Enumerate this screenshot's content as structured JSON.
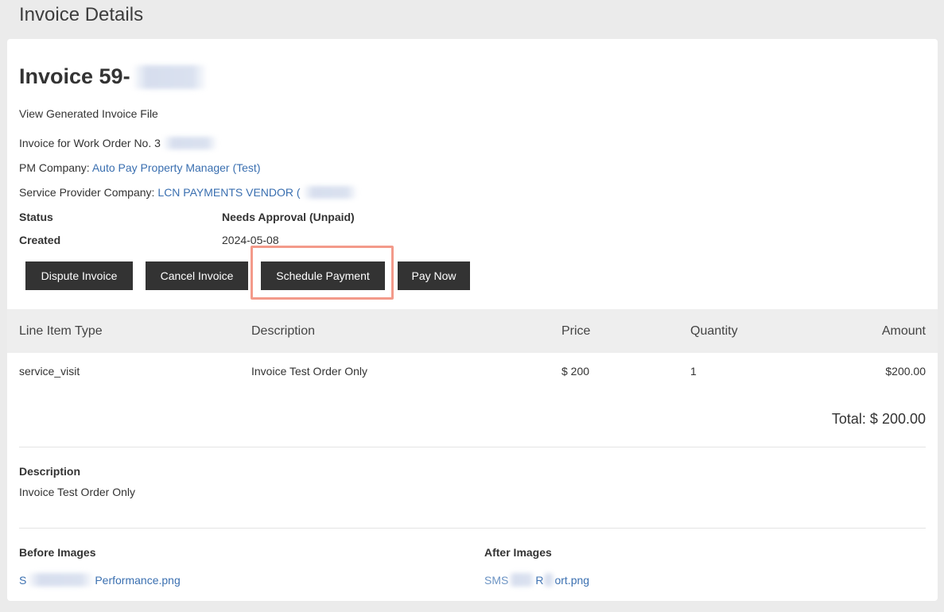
{
  "page": {
    "title": "Invoice Details"
  },
  "invoice": {
    "heading": "Invoice 59-",
    "view_file_link": "View Generated Invoice File",
    "work_order_label": "Invoice for Work Order No. 3",
    "pm_company_label": "PM Company:",
    "pm_company_value": "Auto Pay Property Manager (Test)",
    "sp_company_label": "Service Provider Company:",
    "sp_company_value": "LCN PAYMENTS VENDOR (",
    "status_label": "Status",
    "status_value": "Needs Approval (Unpaid)",
    "created_label": "Created",
    "created_value": "2024-05-08"
  },
  "actions": {
    "dispute": "Dispute Invoice",
    "cancel": "Cancel Invoice",
    "schedule": "Schedule Payment",
    "pay_now": "Pay Now"
  },
  "table": {
    "headers": [
      "Line Item Type",
      "Description",
      "Price",
      "Quantity",
      "Amount"
    ],
    "rows": [
      [
        "service_visit",
        "Invoice Test Order Only",
        "$ 200",
        "1",
        "$200.00"
      ]
    ],
    "total": "Total: $ 200.00"
  },
  "description": {
    "label": "Description",
    "text": "Invoice Test Order Only"
  },
  "images": {
    "before_label": "Before Images",
    "before_file_prefix": "S",
    "before_file_suffix": "Performance.png",
    "after_label": "After Images",
    "after_file_prefix": "SMS",
    "after_file_middle": "R",
    "after_file_suffix": "ort.png"
  },
  "colors": {
    "link": "#3a6fb0",
    "button_bg": "#333333",
    "highlight": "#f39a8a"
  }
}
